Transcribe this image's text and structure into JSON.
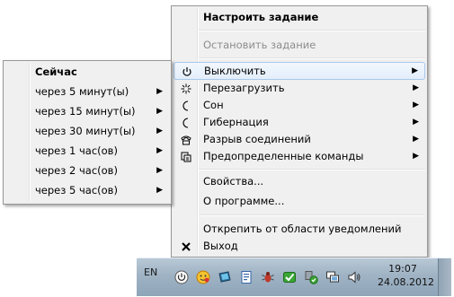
{
  "main_menu": {
    "items": [
      {
        "label": "Настроить задание"
      },
      {
        "label": "Остановить задание"
      },
      {
        "label": "Выключить",
        "icon": "power-icon"
      },
      {
        "label": "Перезагрузить",
        "icon": "restart-icon"
      },
      {
        "label": "Сон",
        "icon": "sleep-moon-icon"
      },
      {
        "label": "Гибернация",
        "icon": "hibernate-moon-icon"
      },
      {
        "label": "Разрыв соединений",
        "icon": "disconnect-phone-icon"
      },
      {
        "label": "Предопределенные команды",
        "icon": "commands-icon"
      },
      {
        "label": "Свойства..."
      },
      {
        "label": "О программе..."
      },
      {
        "label": "Открепить от области уведомлений"
      },
      {
        "label": "Выход",
        "icon": "close-x-icon"
      }
    ]
  },
  "sub_menu": {
    "items": [
      {
        "label": "Сейчас"
      },
      {
        "label": "через 5 минут(ы)"
      },
      {
        "label": "через 15 минут(ы)"
      },
      {
        "label": "через 30 минут(ы)"
      },
      {
        "label": "через 1 час(ов)"
      },
      {
        "label": "через 2 час(ов)"
      },
      {
        "label": "через 5 час(ов)"
      }
    ]
  },
  "taskbar": {
    "language": "EN",
    "time": "19:07",
    "date": "24.08.2012",
    "tray_icons": [
      "power-tray-icon",
      "smiley-tray-icon",
      "monitor-tray-icon",
      "document-tray-icon",
      "bug-tray-icon",
      "green-check-tray-icon",
      "shield-tray-icon",
      "network-tray-icon",
      "speaker-tray-icon"
    ]
  },
  "colors": {
    "menu_bg": "#f0f0f0",
    "highlight_border": "#a8c8ec",
    "disabled_text": "#8d8d8d",
    "taskbar_bg": "#9fb3c4"
  }
}
